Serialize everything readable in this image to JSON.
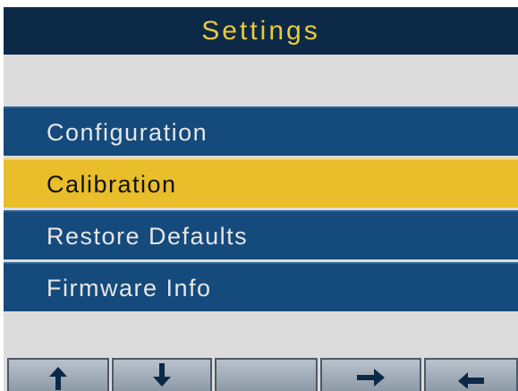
{
  "header": {
    "title": "Settings"
  },
  "menu": {
    "selected_index": 1,
    "items": [
      {
        "label": "Configuration"
      },
      {
        "label": "Calibration"
      },
      {
        "label": "Restore Defaults"
      },
      {
        "label": "Firmware Info"
      }
    ]
  },
  "softkeys": [
    {
      "icon": "up-arrow-icon",
      "glyph": "🡡"
    },
    {
      "icon": "down-arrow-icon",
      "glyph": "🡣"
    },
    {
      "icon": "",
      "glyph": ""
    },
    {
      "icon": "right-arrow-icon",
      "glyph": "🡢"
    },
    {
      "icon": "back-arrow-icon",
      "glyph": "⇠"
    }
  ],
  "colors": {
    "title_bg": "#0c2947",
    "title_text": "#e8cb3e",
    "menu_bg": "#154a7c",
    "menu_text": "#e6e6e6",
    "selected_bg": "#e9be2a",
    "screen_bg": "#dcdcdc"
  }
}
